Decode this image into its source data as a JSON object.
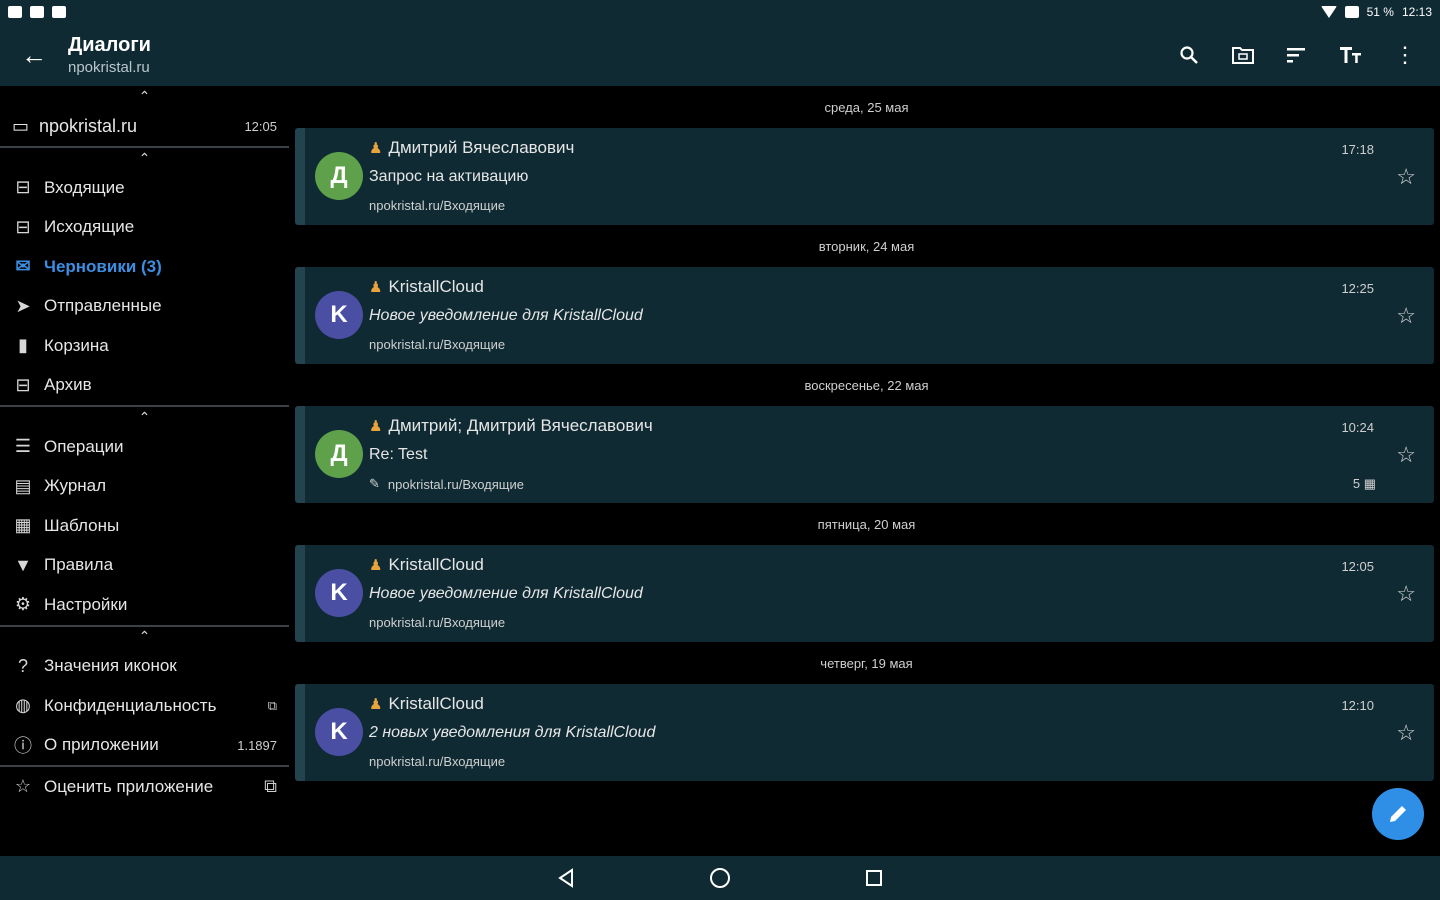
{
  "status_bar": {
    "battery": "51 %",
    "time": "12:13"
  },
  "app_bar": {
    "title": "Диалоги",
    "subtitle": "npokristal.ru",
    "actions": [
      "search-icon",
      "folder-icon",
      "sort-icon",
      "text-size-icon",
      "more-vert-icon"
    ]
  },
  "sidebar": {
    "account": {
      "name": "npokristal.ru",
      "time": "12:05"
    },
    "folders": [
      {
        "icon": "inbox-icon",
        "glyph": "⊟",
        "label": "Входящие"
      },
      {
        "icon": "outbox-icon",
        "glyph": "⊟",
        "label": "Исходящие"
      },
      {
        "icon": "drafts-icon",
        "glyph": "✉",
        "label": "Черновики (3)",
        "active": true
      },
      {
        "icon": "send-icon",
        "glyph": "➤",
        "label": "Отправленные"
      },
      {
        "icon": "trash-icon",
        "glyph": "▮",
        "label": "Корзина"
      },
      {
        "icon": "archive-icon",
        "glyph": "⊟",
        "label": "Архив"
      }
    ],
    "tools": [
      {
        "icon": "operations-icon",
        "glyph": "☰",
        "label": "Операции"
      },
      {
        "icon": "log-icon",
        "glyph": "▤",
        "label": "Журнал"
      },
      {
        "icon": "templates-icon",
        "glyph": "▦",
        "label": "Шаблоны"
      },
      {
        "icon": "filter-icon",
        "glyph": "▼",
        "label": "Правила"
      },
      {
        "icon": "settings-icon",
        "glyph": "⚙",
        "label": "Настройки"
      }
    ],
    "info": [
      {
        "icon": "help-icon",
        "glyph": "?",
        "label": "Значения иконок",
        "right": ""
      },
      {
        "icon": "privacy-icon",
        "glyph": "◍",
        "label": "Конфиденциальность",
        "right": "⧉"
      },
      {
        "icon": "info-icon",
        "glyph": "ⓘ",
        "label": "О приложении",
        "right": "1.1897"
      }
    ],
    "rate": {
      "icon": "star-outline-icon",
      "glyph": "☆",
      "label": "Оценить приложение",
      "right": "⧉"
    }
  },
  "messages": [
    {
      "date": "среда, 25 мая",
      "avatar": "Д",
      "avatar_color": "#5fa14b",
      "from": "Дмитрий Вячеславович",
      "subject": "Запрос на активацию",
      "subject_italic": false,
      "folder": "npokristal.ru/Входящие",
      "time": "17:18",
      "count": "",
      "draft": false
    },
    {
      "date": "вторник, 24 мая",
      "avatar": "K",
      "avatar_color": "#4a4fa3",
      "from": "KristallCloud",
      "subject": "Новое уведомление для KristallCloud",
      "subject_italic": true,
      "folder": "npokristal.ru/Входящие",
      "time": "12:25",
      "count": "",
      "draft": false
    },
    {
      "date": "воскресенье, 22 мая",
      "avatar": "Д",
      "avatar_color": "#5fa14b",
      "from": "Дмитрий; Дмитрий Вячеславович",
      "subject": "Re: Test",
      "subject_italic": false,
      "folder": "npokristal.ru/Входящие",
      "time": "10:24",
      "count": "5 ▦",
      "draft": true
    },
    {
      "date": "пятница, 20 мая",
      "avatar": "K",
      "avatar_color": "#4a4fa3",
      "from": "KristallCloud",
      "subject": "Новое уведомление для KristallCloud",
      "subject_italic": true,
      "folder": "npokristal.ru/Входящие",
      "time": "12:05",
      "count": "",
      "draft": false
    },
    {
      "date": "четверг, 19 мая",
      "avatar": "K",
      "avatar_color": "#4a4fa3",
      "from": "KristallCloud",
      "subject": "2 новых уведомления для KristallCloud",
      "subject_italic": true,
      "folder": "npokristal.ru/Входящие",
      "time": "12:10",
      "count": "",
      "draft": false
    }
  ],
  "colors": {
    "accent": "#2f8fe6",
    "bar": "#0f2a33",
    "card": "#0f2a33"
  }
}
